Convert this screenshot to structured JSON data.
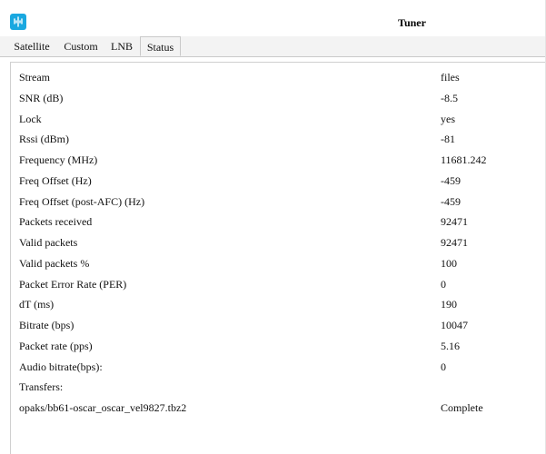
{
  "window": {
    "title": "Tuner"
  },
  "tabs": [
    {
      "label": "Satellite",
      "active": false
    },
    {
      "label": "Custom",
      "active": false
    },
    {
      "label": "LNB",
      "active": false
    },
    {
      "label": "Status",
      "active": true
    }
  ],
  "status_rows": [
    {
      "key": "Stream",
      "value": "files"
    },
    {
      "key": "SNR (dB)",
      "value": "-8.5"
    },
    {
      "key": "Lock",
      "value": "yes"
    },
    {
      "key": "Rssi (dBm)",
      "value": "-81"
    },
    {
      "key": "Frequency (MHz)",
      "value": "11681.242"
    },
    {
      "key": "Freq Offset (Hz)",
      "value": "-459"
    },
    {
      "key": "Freq Offset (post-AFC) (Hz)",
      "value": "-459"
    },
    {
      "key": "Packets received",
      "value": "92471"
    },
    {
      "key": "Valid packets",
      "value": "92471"
    },
    {
      "key": "Valid packets %",
      "value": "100"
    },
    {
      "key": "Packet Error Rate (PER)",
      "value": "0"
    },
    {
      "key": "dT (ms)",
      "value": "190"
    },
    {
      "key": "Bitrate (bps)",
      "value": "10047"
    },
    {
      "key": "Packet rate (pps)",
      "value": "5.16"
    },
    {
      "key": "Audio bitrate(bps):",
      "value": "0"
    },
    {
      "key": "Transfers:",
      "value": ""
    },
    {
      "key": "opaks/bb61-oscar_oscar_vel9827.tbz2",
      "value": "Complete"
    }
  ],
  "colors": {
    "app_icon": "#1aa8e0",
    "panel_border": "#d0d0d0"
  },
  "icons": {
    "app": "antenna-icon"
  }
}
